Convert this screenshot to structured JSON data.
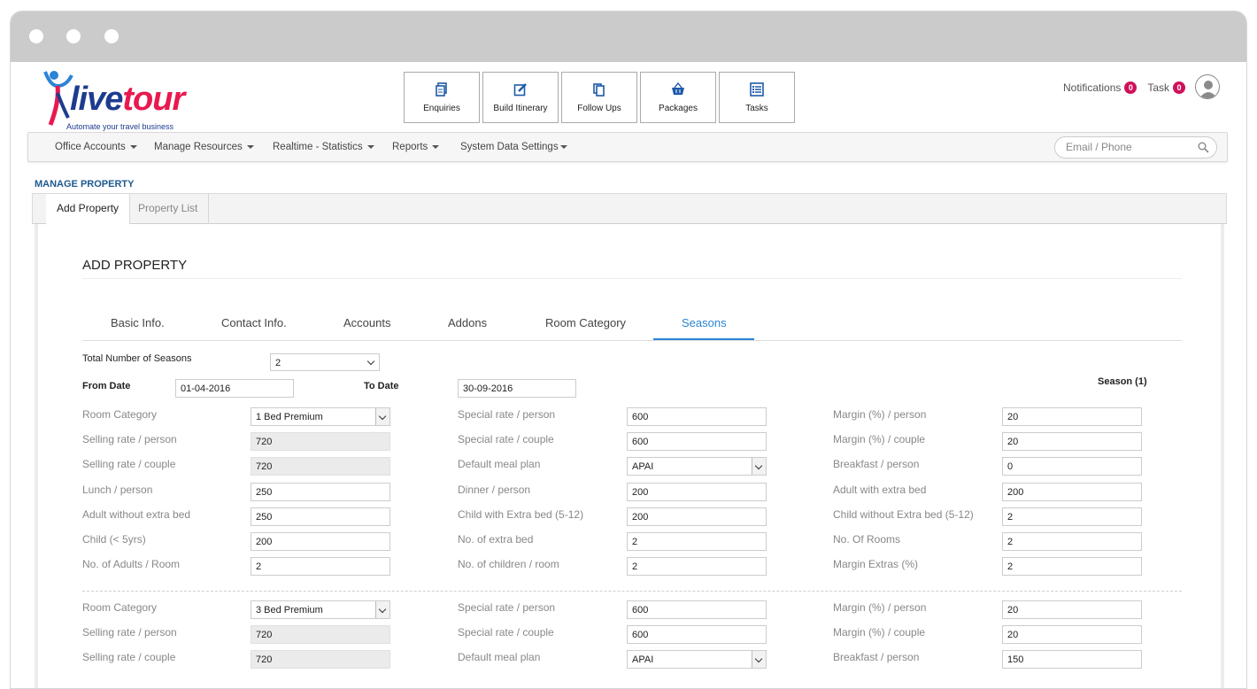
{
  "brand": {
    "logo_main": "live",
    "logo_accent": "tour",
    "tagline": "Automate your travel business"
  },
  "toolbar": [
    {
      "label": "Enquiries",
      "icon": "copy-icon"
    },
    {
      "label": "Build Itinerary",
      "icon": "edit-icon"
    },
    {
      "label": "Follow Ups",
      "icon": "files-icon"
    },
    {
      "label": "Packages",
      "icon": "basket-icon"
    },
    {
      "label": "Tasks",
      "icon": "checklist-icon"
    }
  ],
  "header": {
    "notifications_label": "Notifications",
    "notifications_count": "0",
    "task_label": "Task",
    "task_count": "0"
  },
  "nav": {
    "items": [
      "Office Accounts",
      "Manage Resources",
      "Realtime - Statistics",
      "Reports",
      "System Data Settings"
    ],
    "search_placeholder": "Email / Phone"
  },
  "section_title": "MANAGE PROPERTY",
  "subtabs": [
    "Add Property",
    "Property List"
  ],
  "form": {
    "title": "ADD PROPERTY",
    "tabs": [
      "Basic Info.",
      "Contact Info.",
      "Accounts",
      "Addons",
      "Room Category",
      "Seasons"
    ],
    "active_tab": "Seasons",
    "total_seasons_label": "Total Number of Seasons",
    "total_seasons_value": "2",
    "from_date_label": "From Date",
    "from_date_value": "01-04-2016",
    "to_date_label": "To Date",
    "to_date_value": "30-09-2016",
    "season_label": "Season (1)"
  },
  "rooms": [
    {
      "col1": [
        {
          "label": "Room Category",
          "value": "1 Bed Premium",
          "type": "select"
        },
        {
          "label": "Selling rate / person",
          "value": "720",
          "type": "readonly"
        },
        {
          "label": "Selling rate / couple",
          "value": "720",
          "type": "readonly"
        },
        {
          "label": "Lunch / person",
          "value": "250",
          "type": "input"
        },
        {
          "label": "Adult without extra bed",
          "value": "250",
          "type": "input"
        },
        {
          "label": "Child (< 5yrs)",
          "value": "200",
          "type": "input"
        },
        {
          "label": "No. of Adults / Room",
          "value": "2",
          "type": "input"
        }
      ],
      "col2": [
        {
          "label": "Special rate / person",
          "value": "600",
          "type": "input"
        },
        {
          "label": "Special rate / couple",
          "value": "600",
          "type": "input"
        },
        {
          "label": "Default meal plan",
          "value": "APAI",
          "type": "select"
        },
        {
          "label": "Dinner / person",
          "value": "200",
          "type": "input"
        },
        {
          "label": "Child with Extra bed (5-12)",
          "value": "200",
          "type": "input"
        },
        {
          "label": "No. of extra bed",
          "value": "2",
          "type": "input"
        },
        {
          "label": "No. of children / room",
          "value": "2",
          "type": "input"
        }
      ],
      "col3": [
        {
          "label": "Margin (%) / person",
          "value": "20",
          "type": "input"
        },
        {
          "label": "Margin (%) / couple",
          "value": "20",
          "type": "input"
        },
        {
          "label": "Breakfast / person",
          "value": "0",
          "type": "input"
        },
        {
          "label": "Adult with extra bed",
          "value": "200",
          "type": "input"
        },
        {
          "label": "Child without Extra bed (5-12)",
          "value": "2",
          "type": "input"
        },
        {
          "label": "No. Of Rooms",
          "value": "2",
          "type": "input"
        },
        {
          "label": "Margin Extras (%)",
          "value": "2",
          "type": "input"
        }
      ]
    },
    {
      "col1": [
        {
          "label": "Room Category",
          "value": "3 Bed Premium",
          "type": "select"
        },
        {
          "label": "Selling rate / person",
          "value": "720",
          "type": "readonly"
        },
        {
          "label": "Selling rate / couple",
          "value": "720",
          "type": "readonly"
        }
      ],
      "col2": [
        {
          "label": "Special rate / person",
          "value": "600",
          "type": "input"
        },
        {
          "label": "Special rate / couple",
          "value": "600",
          "type": "input"
        },
        {
          "label": "Default meal plan",
          "value": "APAI",
          "type": "select"
        }
      ],
      "col3": [
        {
          "label": "Margin (%) / person",
          "value": "20",
          "type": "input"
        },
        {
          "label": "Margin (%) / couple",
          "value": "20",
          "type": "input"
        },
        {
          "label": "Breakfast / person",
          "value": "150",
          "type": "input"
        }
      ]
    }
  ],
  "colors": {
    "brand_blue": "#1d3c8f",
    "brand_pink": "#e8194f",
    "accent": "#2b84d6",
    "badge": "#d0105a"
  }
}
